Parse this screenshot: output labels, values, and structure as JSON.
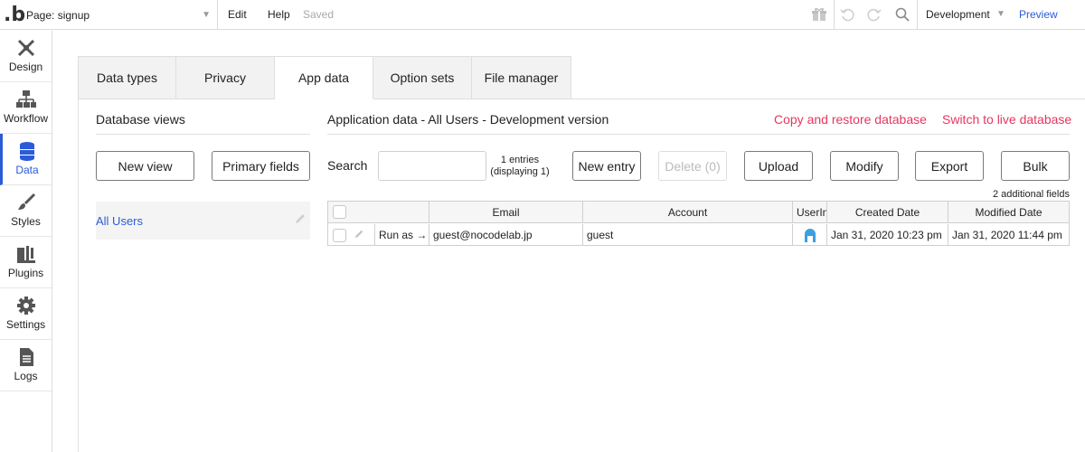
{
  "topbar": {
    "logo": ".b",
    "page_label": "Page: signup",
    "menu_edit": "Edit",
    "menu_help": "Help",
    "saved_status": "Saved",
    "environment": "Development",
    "preview": "Preview"
  },
  "sidebar": {
    "items": [
      {
        "label": "Design",
        "icon": "design-icon"
      },
      {
        "label": "Workflow",
        "icon": "workflow-icon"
      },
      {
        "label": "Data",
        "icon": "database-icon",
        "active": true
      },
      {
        "label": "Styles",
        "icon": "brush-icon"
      },
      {
        "label": "Plugins",
        "icon": "plug-icon"
      },
      {
        "label": "Settings",
        "icon": "gear-icon"
      },
      {
        "label": "Logs",
        "icon": "document-icon"
      }
    ]
  },
  "tabs": [
    {
      "label": "Data types"
    },
    {
      "label": "Privacy"
    },
    {
      "label": "App data",
      "active": true
    },
    {
      "label": "Option sets"
    },
    {
      "label": "File manager"
    }
  ],
  "db_views": {
    "title": "Database views",
    "new_view": "New view",
    "primary_fields": "Primary fields",
    "items": [
      {
        "label": "All Users"
      }
    ]
  },
  "app_data": {
    "title": "Application data - All Users - Development version",
    "copy_restore": "Copy and restore database",
    "switch_live": "Switch to live database",
    "search_label": "Search",
    "search_value": "",
    "entries_line1": "1 entries",
    "entries_line2": "(displaying 1)",
    "buttons": {
      "new_entry": "New entry",
      "delete": "Delete (0)",
      "upload": "Upload",
      "modify": "Modify",
      "export": "Export",
      "bulk": "Bulk"
    },
    "additional_fields": "2 additional fields",
    "columns": [
      "Email",
      "Account",
      "UserIn",
      "Created Date",
      "Modified Date"
    ],
    "rows": [
      {
        "run_as": "Run as →",
        "email": "guest@nocodelab.jp",
        "account": "guest",
        "created": "Jan 31, 2020 10:23 pm",
        "modified": "Jan 31, 2020 11:44 pm"
      }
    ]
  },
  "colors": {
    "accent": "#2b5bd7",
    "danger_link": "#e8365d"
  }
}
